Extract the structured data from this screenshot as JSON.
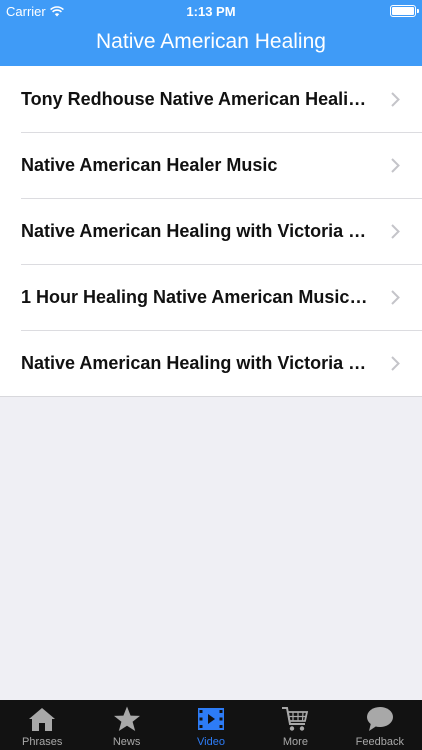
{
  "status": {
    "carrier": "Carrier",
    "time": "1:13 PM"
  },
  "nav": {
    "title": "Native American Healing"
  },
  "videos": [
    {
      "title": "Tony Redhouse Native American Healin..."
    },
    {
      "title": "Native American Healer Music"
    },
    {
      "title": "Native American Healing with Victoria F..."
    },
    {
      "title": "1 Hour Healing Native American Music b..."
    },
    {
      "title": "Native American Healing with Victoria F..."
    }
  ],
  "tabs": [
    {
      "label": "Phrases",
      "icon": "house-icon"
    },
    {
      "label": "News",
      "icon": "star-icon"
    },
    {
      "label": "Video",
      "icon": "film-icon",
      "active": true
    },
    {
      "label": "More",
      "icon": "cart-icon"
    },
    {
      "label": "Feedback",
      "icon": "speech-bubble-icon"
    }
  ],
  "colors": {
    "header": "#3f9bf7",
    "tabbar": "#121212",
    "active_tab": "#2d7cf6",
    "background": "#efeff4"
  }
}
